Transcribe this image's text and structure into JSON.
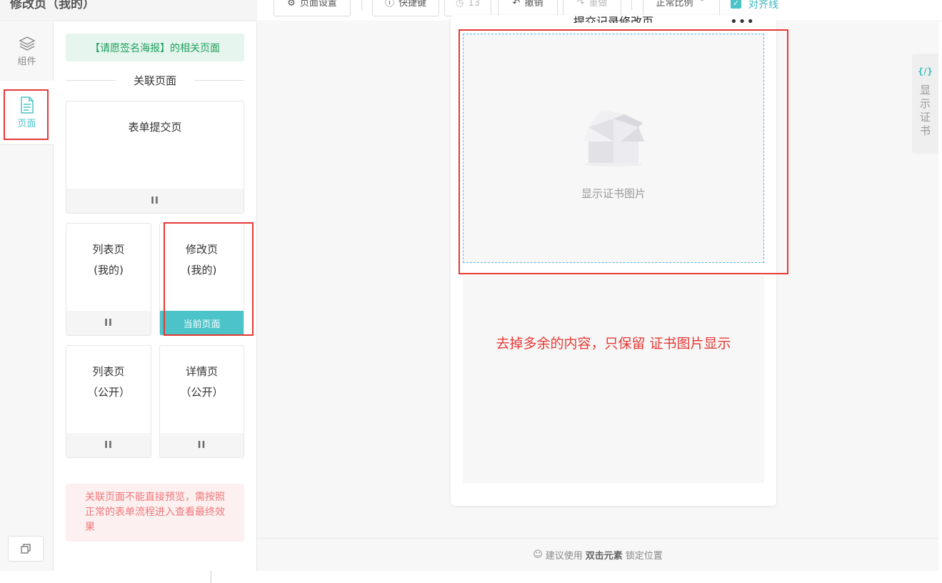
{
  "page_header": {
    "title": "修改页（我的）"
  },
  "toolbar": {
    "page_settings": "页面设置",
    "shortcuts": "快捷键",
    "history_count": "13",
    "undo": "撤销",
    "redo": "重做",
    "zoom": "正常比例",
    "align_lines": "对齐线",
    "align_checked": true
  },
  "rail": {
    "components": "组件",
    "pages": "页面"
  },
  "panel": {
    "banner": "【请愿签名海报】的相关页面",
    "section_title": "关联页面",
    "cards": [
      {
        "title": "表单提交页",
        "footer": "II"
      },
      {
        "title": "列表页\n(我的)",
        "footer": "II"
      },
      {
        "title": "修改页\n(我的)",
        "footer": "当前页面"
      },
      {
        "title": "列表页\n（公开）",
        "footer": "II"
      },
      {
        "title": "详情页\n（公开）",
        "footer": "II"
      }
    ],
    "warning": "关联页面不能直接预览，需按照正常的表单流程进入查看最终效果"
  },
  "canvas": {
    "phone_title": "提交记录修改页",
    "more": "•••",
    "image_label": "显示证书图片",
    "annotation": "去掉多余的内容，只保留 证书图片显示"
  },
  "side_tab": {
    "code": "{/}",
    "label": "显\n示\n证\n书"
  },
  "hint": {
    "prefix": "建议使用",
    "emphasis": "双击元素",
    "suffix": "锁定位置"
  },
  "colors": {
    "accent": "#4cc3c8",
    "annotation_red": "#e53935",
    "banner_green": "#1e9e5c"
  }
}
